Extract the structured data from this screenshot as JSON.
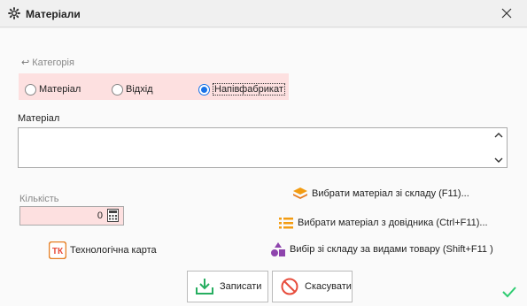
{
  "window": {
    "title": "Матеріали",
    "icon": "gear-icon",
    "close_icon": "close-icon"
  },
  "category": {
    "label": "Категорія",
    "options": [
      {
        "label": "Матеріал",
        "selected": false
      },
      {
        "label": "Відхід",
        "selected": false
      },
      {
        "label": "Напівфабрикат",
        "selected": true
      }
    ],
    "bg_color": "#fde0e0"
  },
  "material": {
    "label": "Матеріал",
    "value": ""
  },
  "quantity": {
    "label": "Кількість",
    "value": "0"
  },
  "actions": {
    "select_from_stock": "Вибрати матеріал зі складу (F11)...",
    "select_from_directory": "Вибрати матеріал з довідника (Ctrl+F11)...",
    "select_by_product_types": "Вибір зі складу за видами товару (Shift+F11 )",
    "tech_card": "Технологічна карта",
    "tech_card_icon_text": "ТК"
  },
  "buttons": {
    "save": "Записати",
    "cancel": "Скасувати"
  },
  "colors": {
    "accent": "#1a73e8",
    "orange": "#f39c12",
    "purple": "#8e44ad",
    "green": "#27ae60",
    "red": "#e74c3c"
  }
}
